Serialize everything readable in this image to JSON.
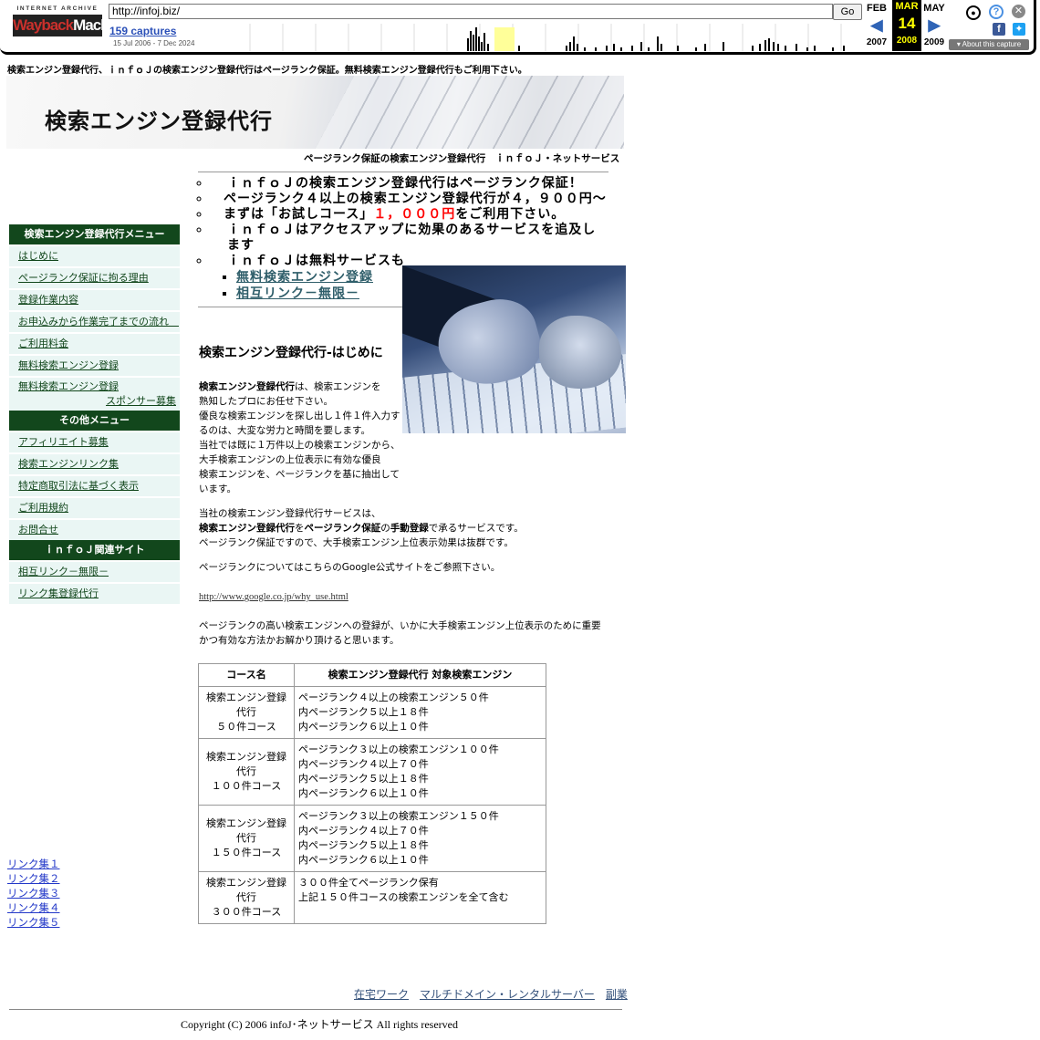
{
  "wayback": {
    "logo_top": "INTERNET ARCHIVE",
    "logo_main_a": "Wayback",
    "logo_main_b": "Machine",
    "url": "http://infoj.biz/",
    "go_label": "Go",
    "captures": "159 captures",
    "date_range": "15 Jul 2006 - 7 Dec 2024",
    "prev_month": "FEB",
    "prev_year": "2007",
    "cur_month": "MAR",
    "cur_day": "14",
    "cur_year": "2008",
    "next_month": "MAY",
    "next_year": "2009",
    "about": "About this capture"
  },
  "page": {
    "top_line": "検索エンジン登録代行、ｉｎｆｏＪの検索エンジン登録代行はページランク保証。無料検索エンジン登録代行もご利用下さい。",
    "banner_title": "検索エンジン登録代行",
    "subtitle": "ページランク保証の検索エンジン登録代行　ｉｎｆｏＪ・ネットサービス"
  },
  "bullets": [
    "ｉｎｆｏＪの検索エンジン登録代行はページランク保証！",
    "ページランク４以上の検索エンジン登録代行が４，９００円～",
    "まずは「お試しコース」",
    "ｉｎｆｏＪはアクセスアップに効果のあるサービスを追及します",
    "ｉｎｆｏＪは無料サービスも"
  ],
  "trial_price": "１，０００円",
  "trial_suffix": "をご利用下さい。",
  "sub_links": [
    "無料検索エンジン登録",
    "相互リンク－無限－"
  ],
  "sidebar": {
    "menu1_title": "検索エンジン登録代行メニュー",
    "menu1": [
      "はじめに",
      "ページランク保証に拘る理由",
      "登録作業内容",
      "お申込みから作業完了までの流れ　",
      "ご利用料金",
      "無料検索エンジン登録"
    ],
    "menu1_last_a": "無料検索エンジン登録",
    "menu1_last_b": "スポンサー募集",
    "menu2_title": "その他メニュー",
    "menu2": [
      "アフィリエイト募集",
      "検索エンジンリンク集",
      "特定商取引法に基づく表示",
      "ご利用規約",
      "お問合せ"
    ],
    "menu3_title": "ｉｎｆｏＪ関連サイト",
    "menu3": [
      "相互リンク－無限－",
      "リンク集登録代行"
    ]
  },
  "link_sets": [
    "リンク集１",
    "リンク集２",
    "リンク集３",
    "リンク集４",
    "リンク集５"
  ],
  "intro": {
    "title": "検索エンジン登録代行-はじめに",
    "p1_bold": "検索エンジン登録代行",
    "p1_a": "は、検索エンジンを",
    "p1_lines": [
      "熟知したプロにお任せ下さい。",
      "優良な検索エンジンを探し出し１件１件入力す",
      "るのは、大変な労力と時間を要します。",
      "当社では既に１万件以上の検索エンジンから、",
      "大手検索エンジンの上位表示に有効な優良",
      "検索エンジンを、ページランクを基に抽出して",
      "います。"
    ],
    "p2_a": "当社の検索エンジン登録代行サービスは、",
    "p2_b1": "検索エンジン登録代行",
    "p2_b2": "を",
    "p2_b3": "ページランク保証",
    "p2_b4": "の",
    "p2_b5": "手動登録",
    "p2_b6": "で承るサービスです。",
    "p2_c": "ページランク保証ですので、大手検索エンジン上位表示効果は抜群です。",
    "p3": "ページランクについてはこちらのGoogle公式サイトをご参照下さい。",
    "p3_link": "http://www.google.co.jp/why_use.html",
    "p4_a": "ページランクの高い検索エンジンへの登録が、いかに大手検索エンジン上位表示のために重要",
    "p4_b": "かつ有効な方法かお解かり頂けると思います。"
  },
  "table": {
    "headers": [
      "コース名",
      "検索エンジン登録代行 対象検索エンジン"
    ],
    "rows": [
      {
        "name": [
          "検索エンジン登録",
          "代行",
          "５０件コース"
        ],
        "desc": [
          "ページランク４以上の検索エンジン５０件",
          "内ページランク５以上１８件",
          "内ページランク６以上１０件"
        ]
      },
      {
        "name": [
          "検索エンジン登録",
          "代行",
          "１００件コース"
        ],
        "desc": [
          "ページランク３以上の検索エンジン１００件",
          "内ページランク４以上７０件",
          "内ページランク５以上１８件",
          "内ページランク６以上１０件"
        ]
      },
      {
        "name": [
          "検索エンジン登録",
          "代行",
          "１５０件コース"
        ],
        "desc": [
          "ページランク３以上の検索エンジン１５０件",
          "内ページランク４以上７０件",
          "内ページランク５以上１８件",
          "内ページランク６以上１０件"
        ]
      },
      {
        "name": [
          "検索エンジン登録",
          "代行",
          "３００件コース"
        ],
        "desc": [
          "３００件全てページランク保有",
          "上記１５０件コースの検索エンジンを全て含む"
        ]
      }
    ]
  },
  "footer": {
    "links": [
      "在宅ワーク",
      "マルチドメイン・レンタルサーバー",
      "副業"
    ],
    "copyright": "Copyright (C) 2006 infoJ･ネットサービス All rights reserved"
  },
  "colors": {
    "sidebar_head": "#12471c",
    "sidebar_item": "#eaf6f4",
    "price_red": "#ff0000",
    "wayback_current": "#ffff00"
  }
}
